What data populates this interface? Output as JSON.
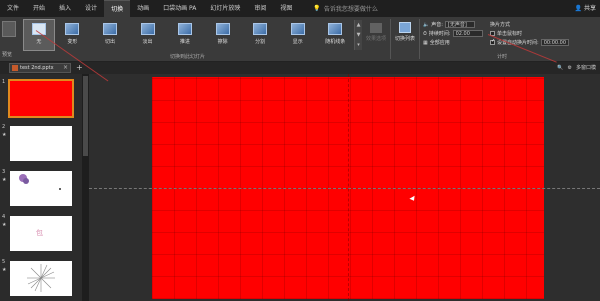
{
  "tabs": [
    "文件",
    "开始",
    "插入",
    "设计",
    "切换",
    "动画",
    "口袋动画 PA",
    "幻灯片放映",
    "审阅",
    "视图"
  ],
  "active_tab_index": 4,
  "tell_me": "告诉我您想要做什么",
  "share_label": "共享",
  "ribbon": {
    "preview_label": "预览",
    "transitions": [
      "无",
      "变形",
      "切出",
      "淡出",
      "推进",
      "擦除",
      "分割",
      "显示",
      "随机线条"
    ],
    "selected_transition_index": 0,
    "effect_options_label": "效果选项",
    "group_transitions_label": "切换到此幻灯片",
    "transition_list_label": "切换列表",
    "sound_label": "声音:",
    "sound_value": "[无声音]",
    "duration_label": "持续时间:",
    "duration_value": "02.00",
    "apply_all_label": "全部应用",
    "advance_label": "换片方式",
    "on_click_label": "单击鼠标时",
    "on_click_checked": false,
    "after_label": "设置自动换片时间:",
    "after_checked": true,
    "after_value": "00:00.00",
    "group_timing_label": "计时"
  },
  "document": {
    "tab_title": "test 2nd.pptx",
    "multi_window_label": "多窗口模"
  },
  "slides": [
    {
      "num": "1",
      "kind": "red"
    },
    {
      "num": "2",
      "kind": "blank",
      "star": "★"
    },
    {
      "num": "3",
      "kind": "purple-shape",
      "star": "★"
    },
    {
      "num": "4",
      "kind": "text-pink",
      "star": "★",
      "text": "包"
    },
    {
      "num": "5",
      "kind": "sunburst",
      "star": "★"
    }
  ],
  "colors": {
    "accent_red": "#ff0000",
    "selection_orange": "#e08a1e",
    "annotation": "#c03a3a"
  }
}
